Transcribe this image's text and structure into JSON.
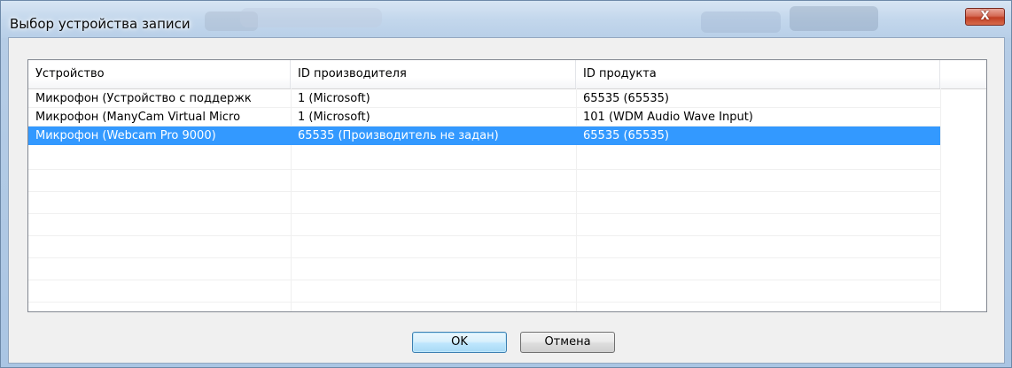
{
  "window": {
    "title": "Выбор устройства записи",
    "close_label": "X"
  },
  "table": {
    "columns": [
      "Устройство",
      "ID производителя",
      "ID продукта",
      ""
    ],
    "rows": [
      {
        "device": "Микрофон (Устройство с поддержк",
        "vendor_id": "1 (Microsoft)",
        "product_id": "65535 (65535)",
        "selected": false
      },
      {
        "device": "Микрофон (ManyCam Virtual Micro",
        "vendor_id": "1 (Microsoft)",
        "product_id": "101 (WDM Audio Wave Input)",
        "selected": false
      },
      {
        "device": "Микрофон (Webcam Pro 9000)",
        "vendor_id": "65535 (Производитель не задан)",
        "product_id": "65535 (65535)",
        "selected": true
      }
    ],
    "selection_color": "#3399ff"
  },
  "buttons": {
    "ok_label": "OK",
    "cancel_label": "Отмена"
  }
}
